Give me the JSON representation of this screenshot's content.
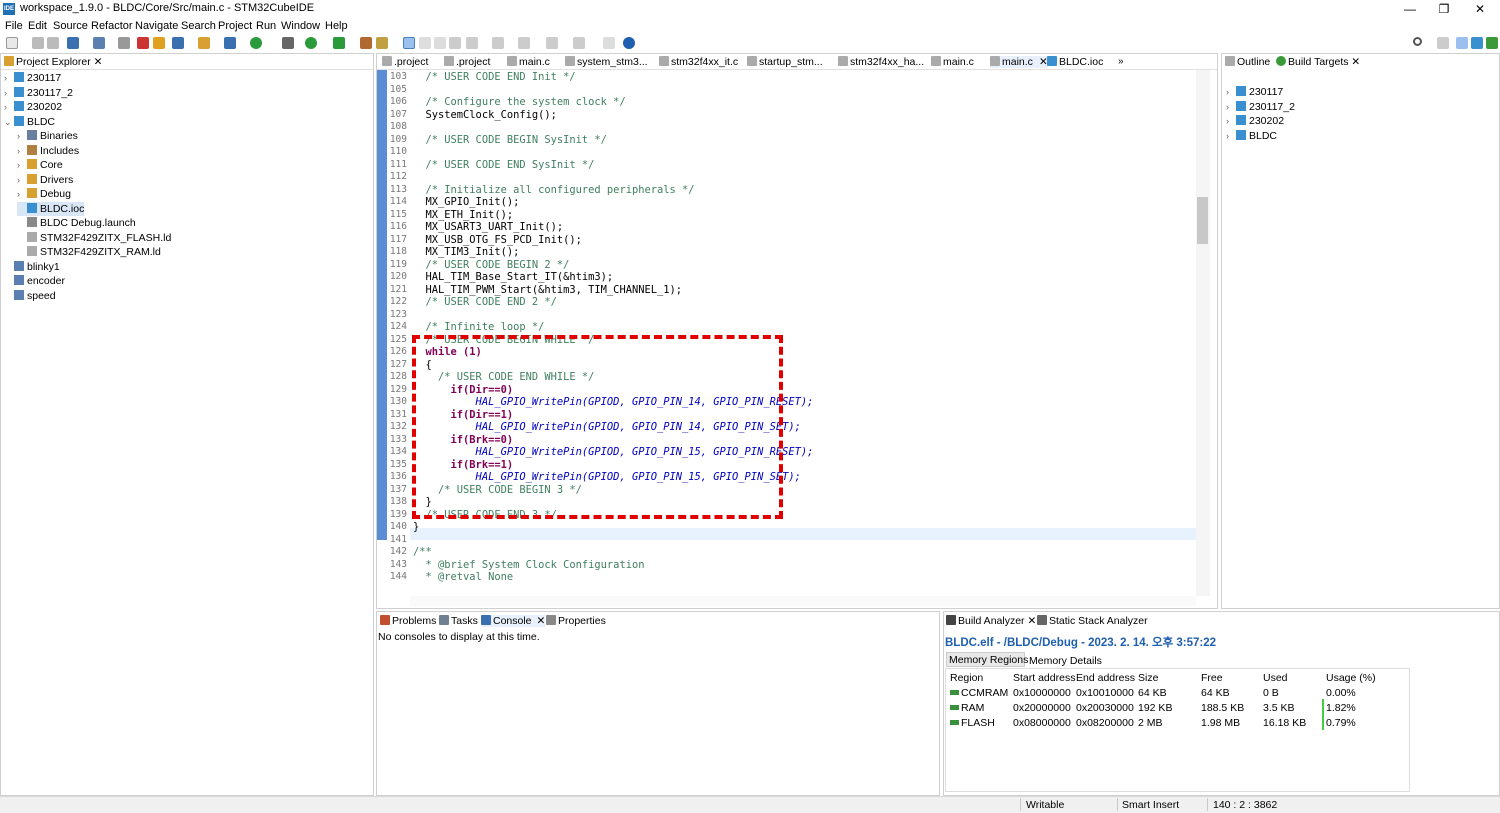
{
  "window": {
    "title": "workspace_1.9.0 - BLDC/Core/Src/main.c - STM32CubeIDE",
    "app_icon": "IDE",
    "minimize": "—",
    "restore": "❐",
    "close": "✕"
  },
  "menu": [
    "File",
    "Edit",
    "Source",
    "Refactor",
    "Navigate",
    "Search",
    "Project",
    "Run",
    "Window",
    "Help"
  ],
  "project_explorer": {
    "title": "Project Explorer",
    "items": [
      {
        "label": "230117",
        "chev": "›"
      },
      {
        "label": "230117_2",
        "chev": "›"
      },
      {
        "label": "230202",
        "chev": "›"
      },
      {
        "label": "BLDC",
        "chev": "⌄"
      },
      {
        "label": "Binaries",
        "chev": "›"
      },
      {
        "label": "Includes",
        "chev": "›"
      },
      {
        "label": "Core",
        "chev": "›"
      },
      {
        "label": "Drivers",
        "chev": "›"
      },
      {
        "label": "Debug",
        "chev": "›"
      },
      {
        "label": "BLDC.ioc",
        "chev": ""
      },
      {
        "label": "BLDC Debug.launch",
        "chev": ""
      },
      {
        "label": "STM32F429ZITX_FLASH.ld",
        "chev": ""
      },
      {
        "label": "STM32F429ZITX_RAM.ld",
        "chev": ""
      },
      {
        "label": "blinky1",
        "chev": ""
      },
      {
        "label": "encoder",
        "chev": ""
      },
      {
        "label": "speed",
        "chev": ""
      }
    ]
  },
  "editor": {
    "tabs": [
      ".project",
      ".project",
      "main.c",
      "system_stm3...",
      "stm32f4xx_it.c",
      "startup_stm...",
      "stm32f4xx_ha...",
      "main.c",
      "main.c",
      "BLDC.ioc"
    ],
    "overflow": "»"
  },
  "code_lines": [
    {
      "n": "103",
      "t": "  /* USER CODE END Init */",
      "c": "cmt"
    },
    {
      "n": "105",
      "t": "",
      "c": ""
    },
    {
      "n": "106",
      "t": "  /* Configure the system clock */",
      "c": "cmt"
    },
    {
      "n": "107",
      "t": "  SystemClock_Config();",
      "c": ""
    },
    {
      "n": "108",
      "t": "",
      "c": ""
    },
    {
      "n": "109",
      "t": "  /* USER CODE BEGIN SysInit */",
      "c": "cmt"
    },
    {
      "n": "110",
      "t": "",
      "c": ""
    },
    {
      "n": "111",
      "t": "  /* USER CODE END SysInit */",
      "c": "cmt"
    },
    {
      "n": "112",
      "t": "",
      "c": ""
    },
    {
      "n": "113",
      "t": "  /* Initialize all configured peripherals */",
      "c": "cmt"
    },
    {
      "n": "114",
      "t": "  MX_GPIO_Init();",
      "c": ""
    },
    {
      "n": "115",
      "t": "  MX_ETH_Init();",
      "c": ""
    },
    {
      "n": "116",
      "t": "  MX_USART3_UART_Init();",
      "c": ""
    },
    {
      "n": "117",
      "t": "  MX_USB_OTG_FS_PCD_Init();",
      "c": ""
    },
    {
      "n": "118",
      "t": "  MX_TIM3_Init();",
      "c": ""
    },
    {
      "n": "119",
      "t": "  /* USER CODE BEGIN 2 */",
      "c": "cmt"
    },
    {
      "n": "120",
      "t": "  HAL_TIM_Base_Start_IT(&htim3);",
      "c": ""
    },
    {
      "n": "121",
      "t": "  HAL_TIM_PWM_Start(&htim3, TIM_CHANNEL_1);",
      "c": ""
    },
    {
      "n": "122",
      "t": "  /* USER CODE END 2 */",
      "c": "cmt"
    },
    {
      "n": "123",
      "t": "",
      "c": ""
    },
    {
      "n": "124",
      "t": "  /* Infinite loop */",
      "c": "cmt"
    },
    {
      "n": "125",
      "t": "  /* USER CODE BEGIN WHILE */",
      "c": "cmt"
    },
    {
      "n": "126",
      "t": "  while (1)",
      "c": "kw"
    },
    {
      "n": "127",
      "t": "  {",
      "c": ""
    },
    {
      "n": "128",
      "t": "    /* USER CODE END WHILE */",
      "c": "cmt"
    },
    {
      "n": "129",
      "t": "      if(Dir==0)",
      "c": "kw"
    },
    {
      "n": "130",
      "t": "          HAL_GPIO_WritePin(GPIOD, GPIO_PIN_14, GPIO_PIN_RESET);",
      "c": "it"
    },
    {
      "n": "131",
      "t": "      if(Dir==1)",
      "c": "kw"
    },
    {
      "n": "132",
      "t": "          HAL_GPIO_WritePin(GPIOD, GPIO_PIN_14, GPIO_PIN_SET);",
      "c": "it"
    },
    {
      "n": "133",
      "t": "      if(Brk==0)",
      "c": "kw"
    },
    {
      "n": "134",
      "t": "          HAL_GPIO_WritePin(GPIOD, GPIO_PIN_15, GPIO_PIN_RESET);",
      "c": "it"
    },
    {
      "n": "135",
      "t": "      if(Brk==1)",
      "c": "kw"
    },
    {
      "n": "136",
      "t": "          HAL_GPIO_WritePin(GPIOD, GPIO_PIN_15, GPIO_PIN_SET);",
      "c": "it"
    },
    {
      "n": "137",
      "t": "    /* USER CODE BEGIN 3 */",
      "c": "cmt"
    },
    {
      "n": "138",
      "t": "  }",
      "c": ""
    },
    {
      "n": "139",
      "t": "  /* USER CODE END 3 */",
      "c": "cmt"
    },
    {
      "n": "140",
      "t": "}",
      "c": ""
    },
    {
      "n": "141",
      "t": "",
      "c": ""
    },
    {
      "n": "142",
      "t": "/**",
      "c": "cmt"
    },
    {
      "n": "143",
      "t": "  * @brief System Clock Configuration",
      "c": "cmt"
    },
    {
      "n": "144",
      "t": "  * @retval None",
      "c": "cmt"
    }
  ],
  "outline": {
    "tabs": [
      "Outline",
      "Build Targets"
    ],
    "items": [
      "230117",
      "230117_2",
      "230202",
      "BLDC"
    ]
  },
  "console": {
    "tabs": [
      "Problems",
      "Tasks",
      "Console",
      "Properties"
    ],
    "message": "No consoles to display at this time."
  },
  "build_analyzer": {
    "tabs": [
      "Build Analyzer",
      "Static Stack Analyzer"
    ],
    "header": "BLDC.elf - /BLDC/Debug - 2023. 2. 14. 오후 3:57:22",
    "subtabs": [
      "Memory Regions",
      "Memory Details"
    ],
    "columns": [
      "Region",
      "Start address",
      "End address",
      "Size",
      "Free",
      "Used",
      "Usage (%)"
    ],
    "rows": [
      [
        "CCMRAM",
        "0x10000000",
        "0x10010000",
        "64 KB",
        "64 KB",
        "0 B",
        "0.00%"
      ],
      [
        "RAM",
        "0x20000000",
        "0x20030000",
        "192 KB",
        "188.5 KB",
        "3.5 KB",
        "1.82%"
      ],
      [
        "FLASH",
        "0x08000000",
        "0x08200000",
        "2 MB",
        "1.98 MB",
        "16.18 KB",
        "0.79%"
      ]
    ]
  },
  "status": {
    "writable": "Writable",
    "insert": "Smart Insert",
    "position": "140 : 2 : 3862"
  },
  "colors": {
    "highlight_box": "#e00000",
    "accent": "#1f6fb5"
  }
}
